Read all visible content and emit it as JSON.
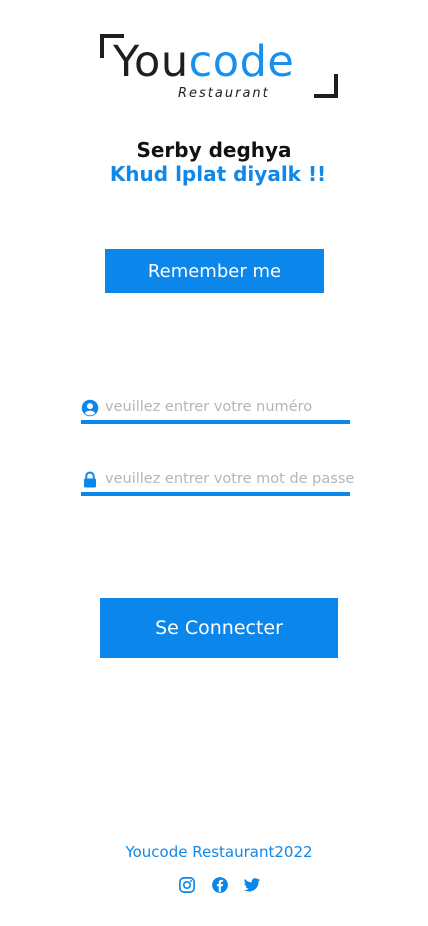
{
  "logo": {
    "part1": "You",
    "part2": "code",
    "subtitle": "Restaurant"
  },
  "heading": {
    "line1": "Serby deghya",
    "line2": "Khud lplat diyalk !!"
  },
  "remember_label": "Remember me",
  "form": {
    "number_placeholder": "veuillez entrer votre numéro",
    "password_placeholder": "veuillez entrer votre mot de passe",
    "submit_label": "Se Connecter"
  },
  "footer": {
    "text": "Youcode Restaurant2022"
  },
  "icons": {
    "user": "user-icon",
    "lock": "lock-icon",
    "instagram": "instagram-icon",
    "facebook": "facebook-icon",
    "twitter": "twitter-icon"
  },
  "colors": {
    "accent": "#0b86ea",
    "text_dark": "#111111"
  }
}
